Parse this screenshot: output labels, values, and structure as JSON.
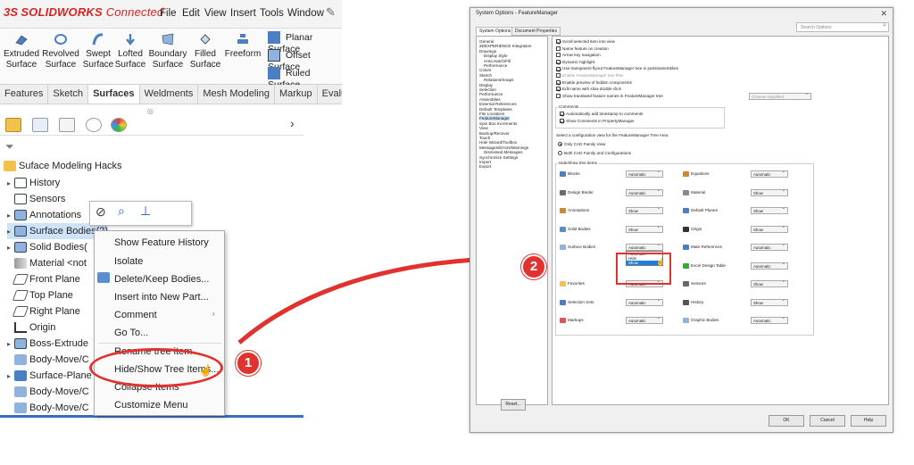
{
  "solidworks": {
    "logo_ds": "3S",
    "logo_name": "SOLIDWORKS",
    "logo_suffix": "Connected",
    "menu": [
      "File",
      "Edit",
      "View",
      "Insert",
      "Tools",
      "Window"
    ],
    "ribbon_buttons": [
      {
        "label": "Extruded\nSurface",
        "icon": "extruded-surface-icon"
      },
      {
        "label": "Revolved\nSurface",
        "icon": "revolved-surface-icon"
      },
      {
        "label": "Swept\nSurface",
        "icon": "swept-surface-icon"
      },
      {
        "label": "Lofted\nSurface",
        "icon": "lofted-surface-icon"
      },
      {
        "label": "Boundary\nSurface",
        "icon": "boundary-surface-icon"
      },
      {
        "label": "Filled\nSurface",
        "icon": "filled-surface-icon"
      },
      {
        "label": "Freeform",
        "icon": "freeform-icon"
      }
    ],
    "ribbon_side": [
      "Planar Surface",
      "Offset Surface",
      "Ruled Surface"
    ],
    "command_tabs": [
      "Features",
      "Sketch",
      "Surfaces",
      "Weldments",
      "Mesh Modeling",
      "Markup",
      "Evaluate"
    ],
    "active_tab": "Surfaces",
    "tree": {
      "root": "Suface Modeling Hacks",
      "items": [
        {
          "label": "History",
          "expand": true
        },
        {
          "label": "Sensors",
          "expand": false
        },
        {
          "label": "Annotations",
          "expand": true
        },
        {
          "label": "Surface Bodies(2)",
          "expand": true,
          "selected": true
        },
        {
          "label": "Solid Bodies(",
          "expand": true
        },
        {
          "label": "Material <not",
          "expand": false
        },
        {
          "label": "Front Plane",
          "expand": false
        },
        {
          "label": "Top Plane",
          "expand": false
        },
        {
          "label": "Right Plane",
          "expand": false
        },
        {
          "label": "Origin",
          "expand": false
        },
        {
          "label": "Boss-Extrude",
          "expand": true
        },
        {
          "label": "Body-Move/C",
          "expand": false
        },
        {
          "label": "Surface-Plane",
          "expand": true
        },
        {
          "label": "Body-Move/C",
          "expand": false
        },
        {
          "label": "Body-Move/C",
          "expand": false
        }
      ]
    },
    "context_menu": [
      "Show Feature History",
      "Isolate",
      "Delete/Keep Bodies...",
      "Insert into New Part...",
      "Comment",
      "Go To...",
      "Rename tree item",
      "Hide/Show Tree Items...",
      "Collapse Items",
      "Customize Menu"
    ],
    "callout_1": "1"
  },
  "dialog": {
    "title": "System Options - FeatureManager",
    "close": "✕",
    "tabs": [
      "System Options",
      "Document Properties"
    ],
    "search_placeholder": "Search Options",
    "nav": [
      {
        "label": "General"
      },
      {
        "label": "3DEXPERIENCE Integration"
      },
      {
        "label": "Drawings"
      },
      {
        "label": "Display Style",
        "sub": true
      },
      {
        "label": "Area Hatch/Fill",
        "sub": true
      },
      {
        "label": "Performance",
        "sub": true
      },
      {
        "label": "Colors"
      },
      {
        "label": "Sketch"
      },
      {
        "label": "Relations/Snaps",
        "sub": true
      },
      {
        "label": "Display"
      },
      {
        "label": "Selection"
      },
      {
        "label": "Performance"
      },
      {
        "label": "Assemblies"
      },
      {
        "label": "External References"
      },
      {
        "label": "Default Templates"
      },
      {
        "label": "File Locations"
      },
      {
        "label": "FeatureManager",
        "selected": true
      },
      {
        "label": "Spin Box Increments"
      },
      {
        "label": "View"
      },
      {
        "label": "Backup/Recover"
      },
      {
        "label": "Touch"
      },
      {
        "label": "Hole Wizard/Toolbox"
      },
      {
        "label": "Messages/Errors/Warnings"
      },
      {
        "label": "Dismissed Messages",
        "sub": true
      },
      {
        "label": "Synchronize Settings"
      },
      {
        "label": "Import"
      },
      {
        "label": "Export"
      }
    ],
    "checkboxes": [
      {
        "label": "Scroll selected item into view",
        "checked": true
      },
      {
        "label": "Name feature on creation",
        "checked": false
      },
      {
        "label": "Arrow key navigation",
        "checked": false
      },
      {
        "label": "Dynamic highlight",
        "checked": true
      },
      {
        "label": "Use transparent flyout FeatureManager tree in parts/assemblies",
        "checked": true
      },
      {
        "label": "Enable FeatureManager tree filter",
        "checked": false,
        "disabled": true
      },
      {
        "label": "Enable preview of hidden components",
        "checked": true
      },
      {
        "label": "Edit name with slow double click",
        "checked": true
      },
      {
        "label": "Show translated feature names in FeatureManager tree",
        "checked": false
      }
    ],
    "translated_dropdown": "Chinese-simplified",
    "comments_title": "Comments",
    "comments": [
      {
        "label": "Automatically add timestamp to comments",
        "checked": true
      },
      {
        "label": "Show Comments in PropertyManager",
        "checked": true
      }
    ],
    "config_prompt": "Select a configuration view for the FeatureManager Tree Area",
    "config_options": [
      {
        "label": "Only CAD Family View",
        "checked": true
      },
      {
        "label": "Both CAD Family and Configurations",
        "checked": false
      }
    ],
    "hide_show_title": "Hide/show tree items",
    "hide_show_left": [
      {
        "label": "Blocks",
        "value": "Automatic"
      },
      {
        "label": "Design Binder",
        "value": "Automatic"
      },
      {
        "label": "Annotations",
        "value": "Show"
      },
      {
        "label": "Solid Bodies",
        "value": "Show"
      },
      {
        "label": "Surface Bodies",
        "value": "Automatic"
      },
      {
        "label": "",
        "value": ""
      },
      {
        "label": "Favorites",
        "value": "Automatic"
      },
      {
        "label": "Selection Sets",
        "value": "Automatic"
      },
      {
        "label": "Markups",
        "value": "Automatic"
      }
    ],
    "hide_show_right": [
      {
        "label": "Equations",
        "value": "Automatic"
      },
      {
        "label": "Material",
        "value": "Show"
      },
      {
        "label": "Default Planes",
        "value": "Show"
      },
      {
        "label": "Origin",
        "value": "Show"
      },
      {
        "label": "Mate References",
        "value": "Automatic"
      },
      {
        "label": "Excel Design Table",
        "value": "Automatic"
      },
      {
        "label": "Sensors",
        "value": "Show"
      },
      {
        "label": "History",
        "value": "Show"
      },
      {
        "label": "Graphic Bodies",
        "value": "Automatic"
      }
    ],
    "dropdown_open_options": [
      "Automatic",
      "Hide",
      "Show"
    ],
    "dropdown_open_highlight": "Show",
    "reset_label": "Reset...",
    "ok_label": "OK",
    "cancel_label": "Cancel",
    "help_label": "Help",
    "callout_2": "2"
  },
  "colors": {
    "accent_red": "#e0332f",
    "selection_blue": "#1e7fd8",
    "tree_blue": "#3a6fbf"
  }
}
